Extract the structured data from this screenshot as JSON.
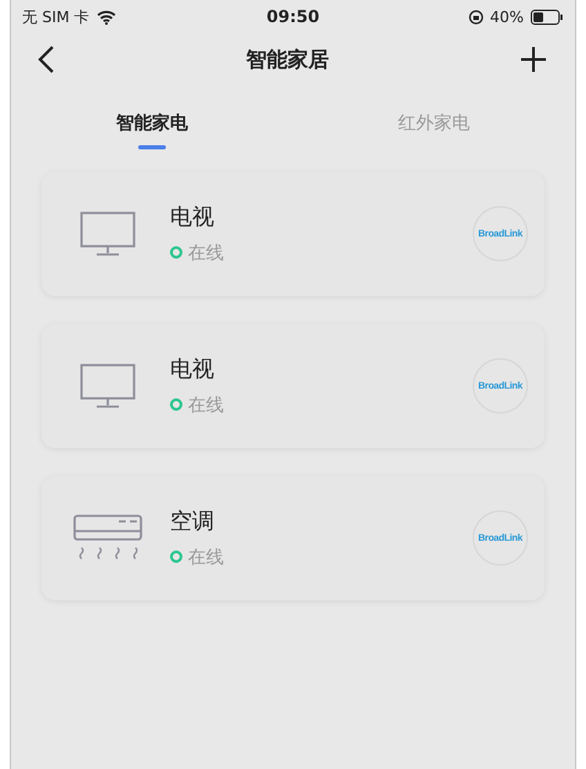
{
  "status_bar": {
    "carrier": "无 SIM 卡",
    "time": "09:50",
    "battery": "40%"
  },
  "nav": {
    "title": "智能家居"
  },
  "tabs": [
    {
      "label": "智能家电",
      "selected": true
    },
    {
      "label": "红外家电",
      "selected": false
    }
  ],
  "devices": [
    {
      "kind": "tv",
      "name": "电视",
      "status": "在线",
      "online": true,
      "brand": "BroadLink"
    },
    {
      "kind": "tv",
      "name": "电视",
      "status": "在线",
      "online": true,
      "brand": "BroadLink"
    },
    {
      "kind": "ac",
      "name": "空调",
      "status": "在线",
      "online": true,
      "brand": "BroadLink"
    }
  ]
}
